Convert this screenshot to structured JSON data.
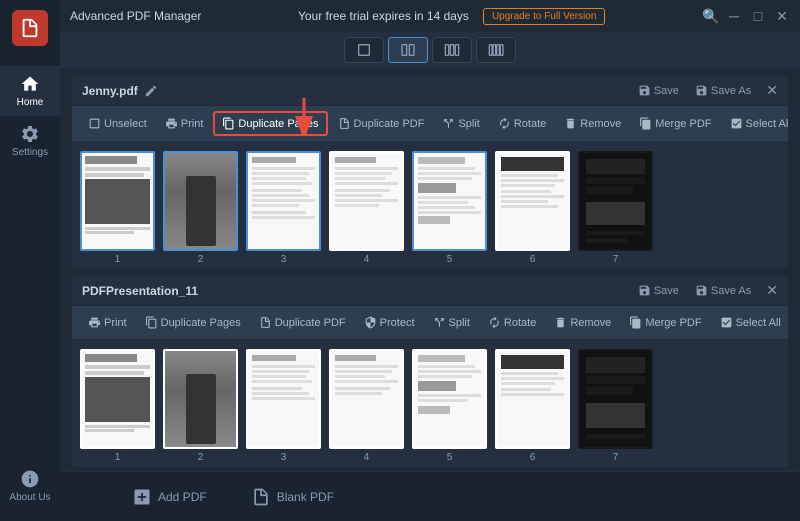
{
  "app": {
    "title": "Advanced PDF Manager",
    "trial_notice": "Your free trial expires in 14 days",
    "upgrade_label": "Upgrade to Full Version"
  },
  "sidebar": {
    "items": [
      {
        "label": "Home",
        "icon": "home"
      },
      {
        "label": "Settings",
        "icon": "settings"
      },
      {
        "label": "About Us",
        "icon": "info"
      }
    ]
  },
  "tabs": [
    {
      "icon": "copy",
      "active": false
    },
    {
      "icon": "grid2",
      "active": true
    },
    {
      "icon": "grid3",
      "active": false
    },
    {
      "icon": "grid4",
      "active": false
    }
  ],
  "pdf1": {
    "filename": "Jenny.pdf",
    "toolbar": {
      "unselect": "Unselect",
      "print": "Print",
      "duplicate_pages": "Duplicate Pages",
      "duplicate_pdf": "Duplicate PDF",
      "split": "Split",
      "rotate": "Rotate",
      "remove": "Remove",
      "merge_pdf": "Merge PDF",
      "select_all": "Select All"
    },
    "save_label": "Save",
    "save_as_label": "Save As",
    "pages": [
      1,
      2,
      3,
      4,
      5,
      6,
      7
    ]
  },
  "pdf2": {
    "filename": "PDFPresentation_11",
    "toolbar": {
      "print": "Print",
      "duplicate_pages": "Duplicate Pages",
      "duplicate_pdf": "Duplicate PDF",
      "protect": "Protect",
      "split": "Split",
      "rotate": "Rotate",
      "remove": "Remove",
      "merge_pdf": "Merge PDF",
      "select_all": "Select All"
    },
    "save_label": "Save",
    "save_as_label": "Save As",
    "pages": [
      1,
      2,
      3,
      4,
      5,
      6,
      7
    ]
  },
  "bottom": {
    "add_pdf_label": "Add PDF",
    "blank_pdf_label": "Blank PDF"
  },
  "colors": {
    "highlight_border": "#e74c3c",
    "selected_page_border": "#4a90d9",
    "upgrade_btn_color": "#e67e22"
  }
}
